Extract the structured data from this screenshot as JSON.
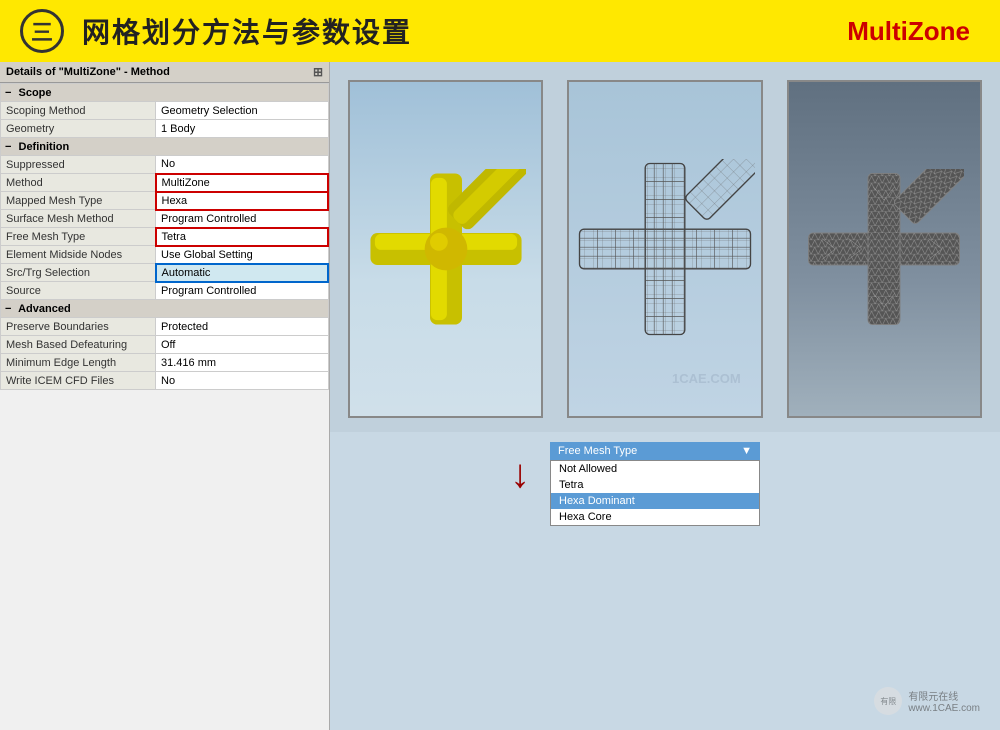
{
  "header": {
    "icon": "三",
    "title": "网格划分方法与参数设置",
    "method_label": "MultiZone"
  },
  "details": {
    "title": "Details of \"MultiZone\" - Method",
    "pin_icon": "📌",
    "sections": [
      {
        "id": "scope",
        "label": "Scope",
        "rows": [
          {
            "label": "Scoping Method",
            "value": "Geometry Selection",
            "highlight": ""
          },
          {
            "label": "Geometry",
            "value": "1 Body",
            "highlight": ""
          }
        ]
      },
      {
        "id": "definition",
        "label": "Definition",
        "rows": [
          {
            "label": "Suppressed",
            "value": "No",
            "highlight": ""
          },
          {
            "label": "Method",
            "value": "MultiZone",
            "highlight": "red"
          },
          {
            "label": "Mapped Mesh Type",
            "value": "Hexa",
            "highlight": "red"
          },
          {
            "label": "Surface Mesh Method",
            "value": "Program Controlled",
            "highlight": ""
          },
          {
            "label": "Free Mesh Type",
            "value": "Tetra",
            "highlight": "red"
          },
          {
            "label": "Element Midside Nodes",
            "value": "Use Global Setting",
            "highlight": ""
          },
          {
            "label": "Src/Trg Selection",
            "value": "Automatic",
            "highlight": "blue"
          },
          {
            "label": "Source",
            "value": "Program Controlled",
            "highlight": ""
          }
        ]
      },
      {
        "id": "advanced",
        "label": "Advanced",
        "rows": [
          {
            "label": "Preserve Boundaries",
            "value": "Protected",
            "highlight": ""
          },
          {
            "label": "Mesh Based Defeaturing",
            "value": "Off",
            "highlight": ""
          },
          {
            "label": "Minimum Edge Length",
            "value": "31.416 mm",
            "highlight": ""
          },
          {
            "label": "Write ICEM CFD Files",
            "value": "No",
            "highlight": ""
          }
        ]
      }
    ]
  },
  "dropdown": {
    "label": "Free Mesh Type",
    "arrow": "▼",
    "options": [
      {
        "text": "Not Allowed",
        "selected": false
      },
      {
        "text": "Tetra",
        "selected": false
      },
      {
        "text": "Hexa Dominant",
        "selected": true
      },
      {
        "text": "Hexa Core",
        "selected": false
      }
    ]
  },
  "images": [
    {
      "id": "model-yellow",
      "alt": "Yellow cross model"
    },
    {
      "id": "model-hexa-mesh",
      "alt": "Hexa mesh cross"
    },
    {
      "id": "model-tetra-mesh",
      "alt": "Tetra mesh cross"
    }
  ],
  "watermark": {
    "site": "www.1CAE.com",
    "brand": "有限元在线"
  }
}
